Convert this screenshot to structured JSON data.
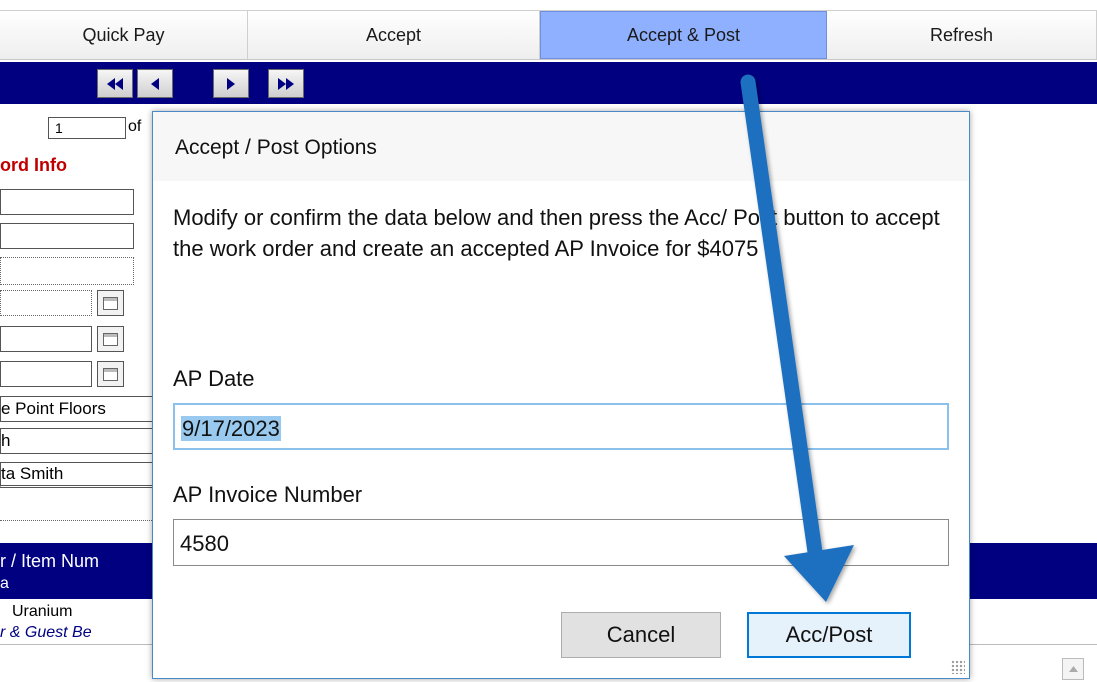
{
  "toolbar": {
    "buttons": [
      "Quick Pay",
      "Accept",
      "Accept & Post",
      "Refresh"
    ]
  },
  "nav": {
    "first": "◀◀",
    "prev": "◀",
    "next": "▶",
    "last": "▶▶"
  },
  "record": {
    "index": "1",
    "of_label": "of",
    "info_heading": "ord Info",
    "vendor": "e Point Floors",
    "contact1": "h",
    "contact2": "ta Smith",
    "column_header_line1": "r / Item Num",
    "column_header_line2": "a",
    "item1": "Uranium",
    "item2": "r & Guest Be"
  },
  "dialog": {
    "title": "Accept / Post Options",
    "message": "Modify or confirm the data below and then press the Acc/ Post button to accept the work order and create an accepted AP Invoice for $4075",
    "ap_date_label": "AP Date",
    "ap_date_value": "9/17/2023",
    "ap_invoice_label": "AP Invoice Number",
    "ap_invoice_value": "4580",
    "cancel_label": "Cancel",
    "accpost_label": "Acc/Post"
  },
  "colors": {
    "navy": "#000080",
    "active_button": "#8fb0ff",
    "annotation_arrow": "#1f6fbf",
    "label_red": "#c00000"
  },
  "icons": [
    "calendar-icon",
    "first-record-icon",
    "previous-record-icon",
    "next-record-icon",
    "last-record-icon",
    "annotation-arrow",
    "resize-grip-icon",
    "scroll-up-icon"
  ]
}
